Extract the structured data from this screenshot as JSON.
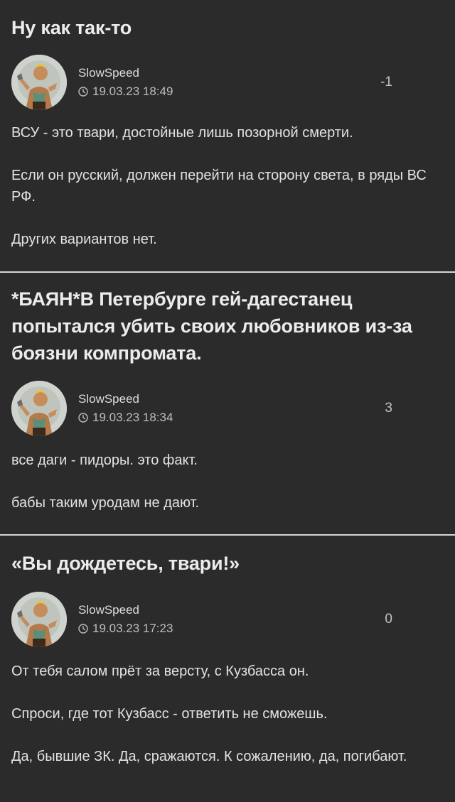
{
  "posts": [
    {
      "title": "Ну как так-то",
      "author": "SlowSpeed",
      "time": "19.03.23 18:49",
      "rating": "-1",
      "paragraphs": [
        "ВСУ - это твари, достойные лишь позорной смерти.",
        "Если он русский, должен перейти на сторону света, в ряды ВС РФ.",
        "Других вариантов нет."
      ]
    },
    {
      "title": "*БАЯН*В Петербурге гей-дагестанец попытался убить своих любовников из-за боязни компромата.",
      "author": "SlowSpeed",
      "time": "19.03.23 18:34",
      "rating": "3",
      "paragraphs": [
        "все даги - пидоры. это факт.",
        "бабы таким уродам не дают."
      ]
    },
    {
      "title": "«Вы дождетесь, твари!»",
      "author": "SlowSpeed",
      "time": "19.03.23 17:23",
      "rating": "0",
      "paragraphs": [
        "От тебя салом прёт за версту, с Кузбасса он.",
        "Спроси, где тот Кузбасс - ответить не сможешь.",
        "Да, бывшие ЗК. Да, сражаются. К сожалению, да, погибают."
      ]
    }
  ],
  "icons": {
    "clock": "clock-icon",
    "avatar": "user-avatar"
  },
  "colors": {
    "background": "#2b2b2b",
    "divider": "#d6d6d6",
    "text": "#e2e2e2",
    "muted": "#bdbdbd"
  }
}
